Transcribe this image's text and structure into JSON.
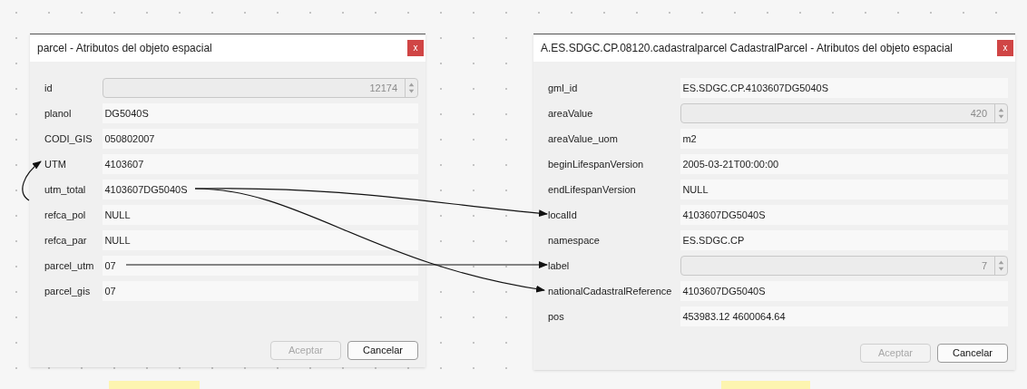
{
  "dialogs": [
    {
      "title": "parcel - Atributos del objeto espacial",
      "close": "x",
      "fields": [
        {
          "label": "id",
          "value": "12174",
          "kind": "spin"
        },
        {
          "label": "planol",
          "value": "DG5040S",
          "kind": "text"
        },
        {
          "label": "CODI_GIS",
          "value": "050802007",
          "kind": "text"
        },
        {
          "label": "UTM",
          "value": "4103607",
          "kind": "text"
        },
        {
          "label": "utm_total",
          "value": "4103607DG5040S",
          "kind": "text"
        },
        {
          "label": "refca_pol",
          "value": "NULL",
          "kind": "text"
        },
        {
          "label": "refca_par",
          "value": "NULL",
          "kind": "text"
        },
        {
          "label": "parcel_utm",
          "value": "07",
          "kind": "text"
        },
        {
          "label": "parcel_gis",
          "value": "07",
          "kind": "text"
        }
      ],
      "buttons": [
        {
          "label": "Aceptar",
          "disabled": true
        },
        {
          "label": "Cancelar",
          "disabled": false
        }
      ]
    },
    {
      "title": "A.ES.SDGC.CP.08120.cadastralparcel CadastralParcel - Atributos del objeto espacial",
      "close": "x",
      "fields": [
        {
          "label": "gml_id",
          "value": "ES.SDGC.CP.4103607DG5040S",
          "kind": "text"
        },
        {
          "label": "areaValue",
          "value": "420",
          "kind": "spin"
        },
        {
          "label": "areaValue_uom",
          "value": "m2",
          "kind": "text"
        },
        {
          "label": "beginLifespanVersion",
          "value": "2005-03-21T00:00:00",
          "kind": "text"
        },
        {
          "label": "endLifespanVersion",
          "value": "NULL",
          "kind": "text"
        },
        {
          "label": "localId",
          "value": "4103607DG5040S",
          "kind": "text"
        },
        {
          "label": "namespace",
          "value": "ES.SDGC.CP",
          "kind": "text"
        },
        {
          "label": "label",
          "value": "7",
          "kind": "spin"
        },
        {
          "label": "nationalCadastralReference",
          "value": "4103607DG5040S",
          "kind": "text"
        },
        {
          "label": "pos",
          "value": "453983.12 4600064.64",
          "kind": "text"
        }
      ],
      "buttons": [
        {
          "label": "Aceptar",
          "disabled": true
        },
        {
          "label": "Cancelar",
          "disabled": false
        }
      ]
    }
  ]
}
